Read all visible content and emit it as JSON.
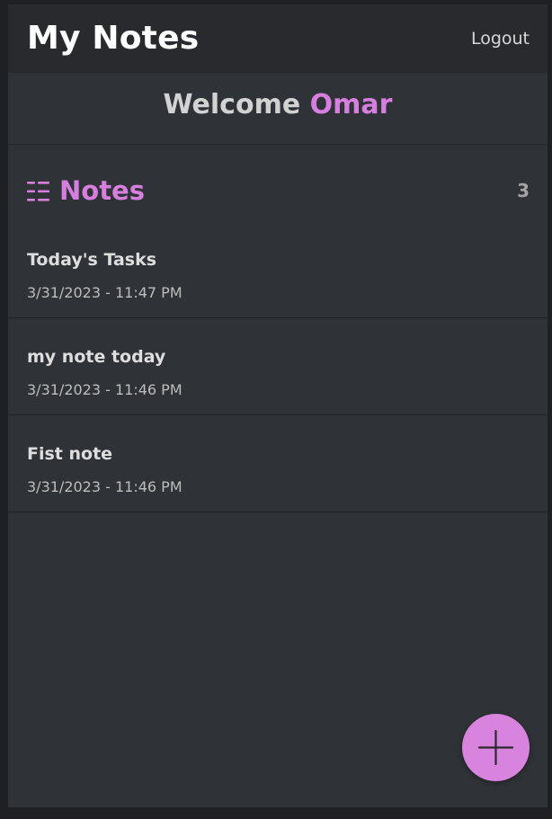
{
  "header": {
    "title": "My Notes",
    "logout_label": "Logout"
  },
  "welcome": {
    "greeting": "Welcome",
    "user_name": "Omar"
  },
  "notes_section": {
    "title": "Notes",
    "count": "3",
    "icon": "list-icon"
  },
  "notes": [
    {
      "title": "Today's Tasks",
      "date": "3/31/2023 - 11:47 PM"
    },
    {
      "title": "my note today",
      "date": "3/31/2023 - 11:46 PM"
    },
    {
      "title": "Fist note",
      "date": "3/31/2023 - 11:46 PM"
    }
  ],
  "fab": {
    "icon": "plus-icon"
  },
  "colors": {
    "accent": "#d67fde",
    "background": "#2f3236",
    "header_bg": "#282a2d"
  }
}
